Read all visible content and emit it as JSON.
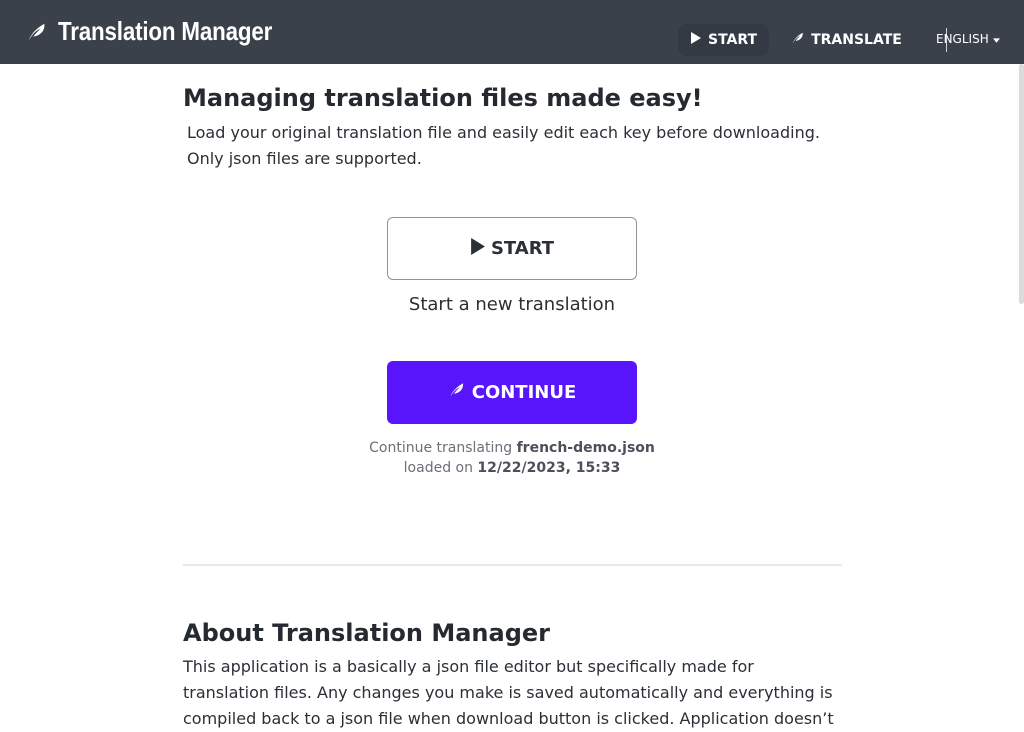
{
  "header": {
    "app_title": "Translation Manager",
    "nav": {
      "start_label": "START",
      "translate_label": "TRANSLATE",
      "language_label": "ENGLISH"
    }
  },
  "main": {
    "headline": "Managing translation files made easy!",
    "lead_line_1": "Load your original translation file and easily edit each key before downloading.",
    "lead_line_2": "Only json files are supported.",
    "start_button_label": "START",
    "start_caption": "Start a new translation",
    "continue_button_label": "CONTINUE",
    "continue_prefix": "Continue translating ",
    "continue_file": "french-demo.json",
    "loaded_prefix": "loaded on ",
    "loaded_date": "12/22/2023, 15:33"
  },
  "about": {
    "title": "About Translation Manager",
    "text": "This application is a basically a json file editor but specifically made for translation files. Any changes you make is saved automatically and everything is compiled back to a json file when download button is clicked. Application doesn’t"
  },
  "icons": {
    "brand": "feather-icon",
    "start": "play-icon",
    "translate": "feather-icon",
    "language": "caret-down-icon"
  },
  "colors": {
    "header_bg": "#3b414b",
    "accent": "#5815fb"
  }
}
